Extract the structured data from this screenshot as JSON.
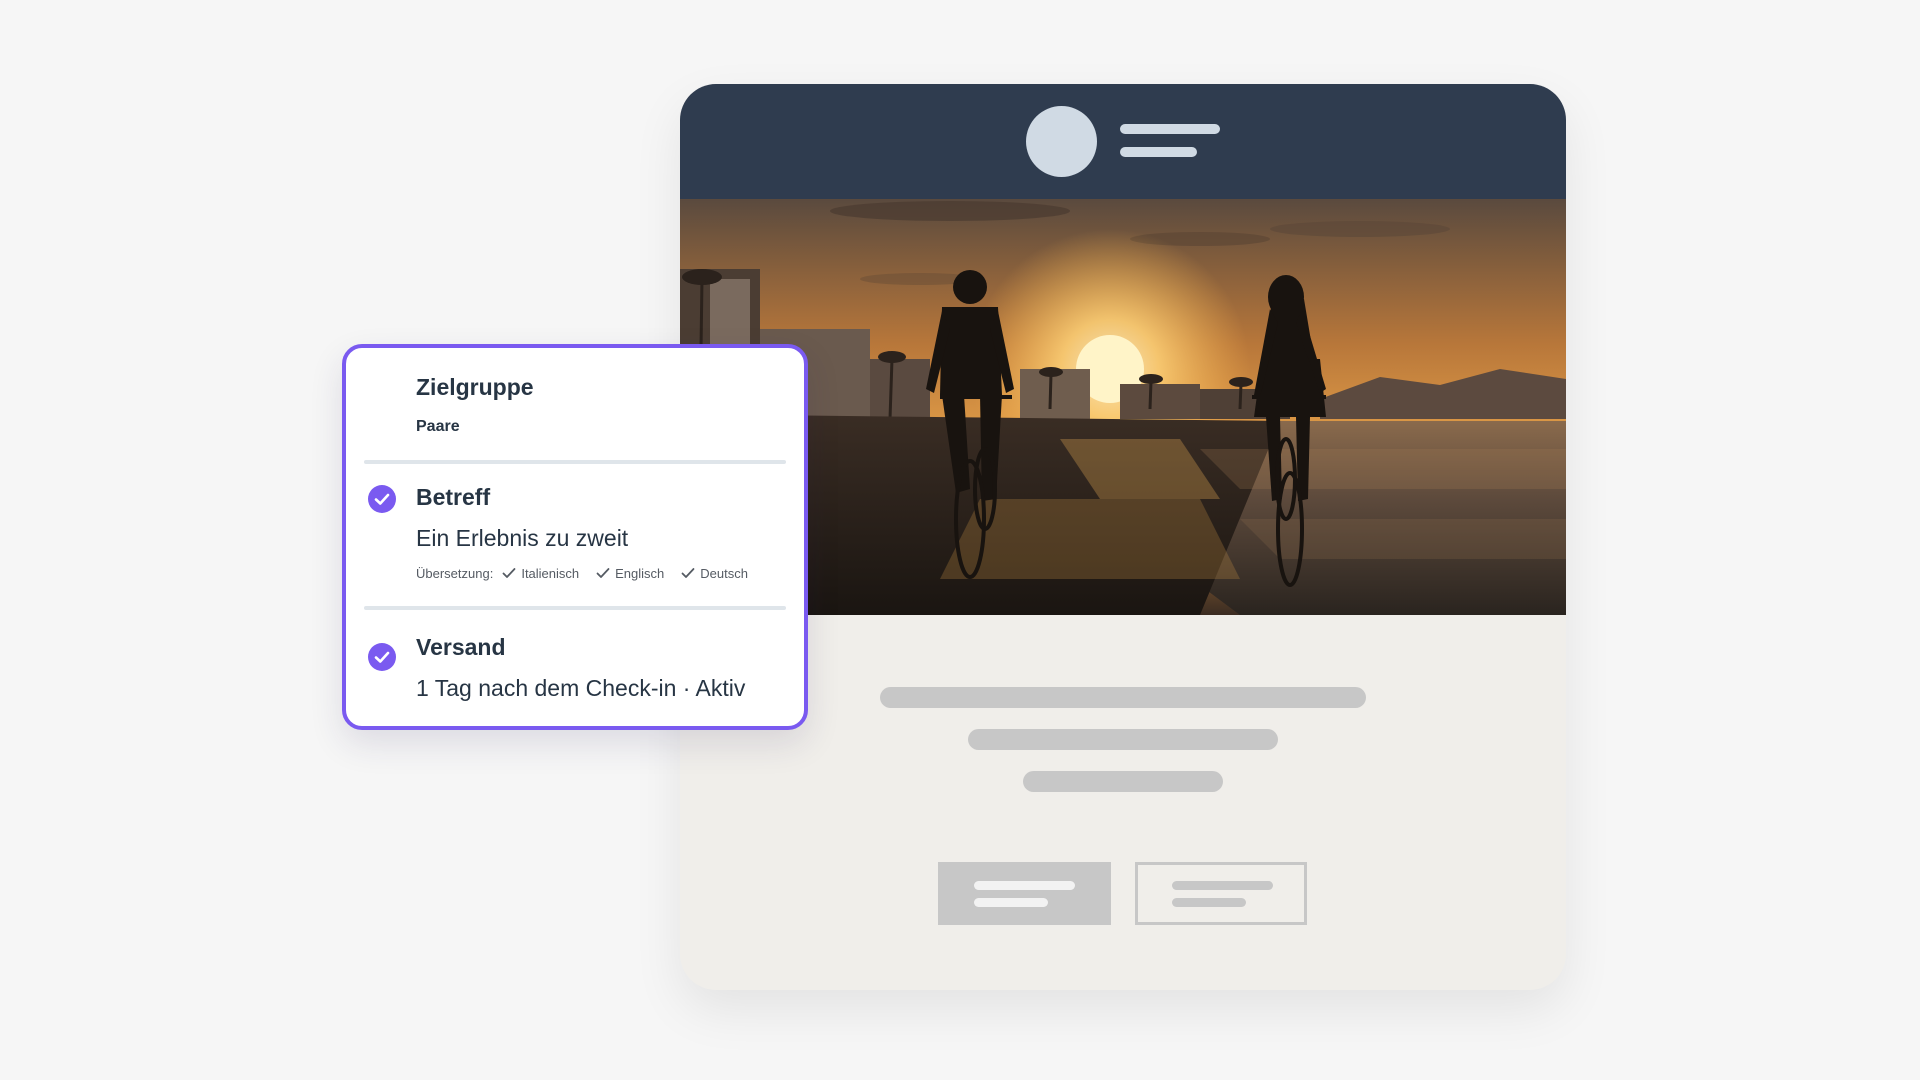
{
  "email_preview": {
    "header": {
      "logo_icon": "circle-logo-placeholder",
      "lines_icon": "text-lines-placeholder"
    },
    "hero_image": {
      "description_icon": "sunset-beach-cyclists-photo"
    },
    "primary_button_icon": "text-lines-placeholder",
    "secondary_button_icon": "text-lines-placeholder"
  },
  "panel": {
    "audience": {
      "title": "Zielgruppe",
      "value": "Paare"
    },
    "subject": {
      "title": "Betreff",
      "value": "Ein Erlebnis zu zweit",
      "translation_label": "Übersetzung:",
      "languages": [
        "Italienisch",
        "Englisch",
        "Deutsch"
      ],
      "icon": "check-circle-icon"
    },
    "delivery": {
      "title": "Versand",
      "value": "1 Tag nach dem Check-in · Aktiv",
      "icon": "check-circle-icon"
    }
  },
  "colors": {
    "accent": "#7a5af0",
    "header_navy": "#2f3c4f",
    "email_bg": "#f0eeea",
    "placeholder_gray": "#c7c7c7"
  }
}
